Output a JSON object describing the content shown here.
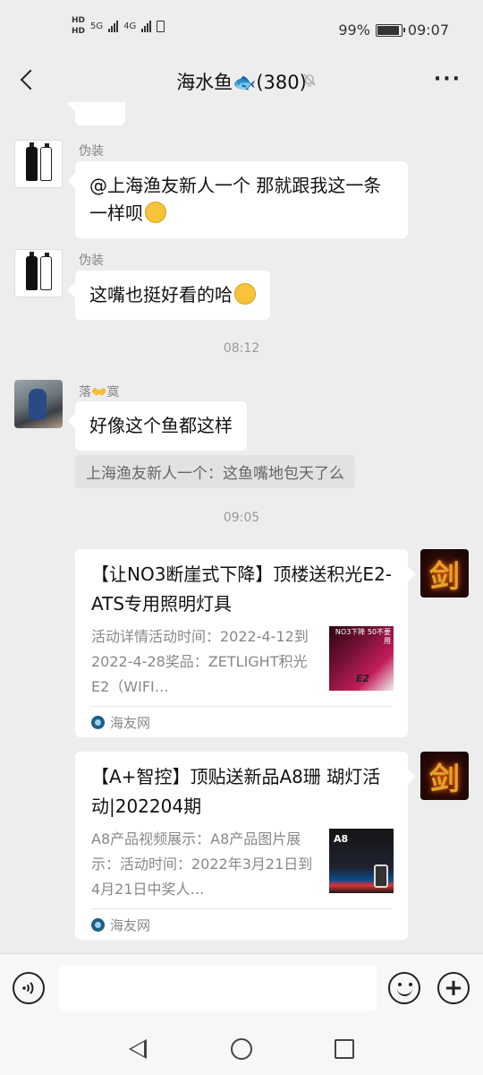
{
  "status_bar": {
    "hd1": "HD",
    "hd2": "HD",
    "net1": "5G",
    "net2": "4G",
    "battery": "99%",
    "time": "09:07"
  },
  "header": {
    "title": "海水鱼🐟(380)",
    "mute_icon": "bell-muted-icon",
    "more_icon": "more-dots-icon"
  },
  "messages": [
    {
      "sender": "伪装",
      "text": "@上海渔友新人一个  那就跟我这一条一样呗"
    },
    {
      "sender": "伪装",
      "text": "这嘴也挺好看的哈"
    },
    {
      "time": "08:12"
    },
    {
      "sender": "落👐寞",
      "text": "好像这个鱼都这样",
      "quote": "上海渔友新人一个：这鱼嘴地包天了么"
    },
    {
      "time": "09:05"
    }
  ],
  "cards": [
    {
      "title": "【让NO3断崖式下降】顶楼送积光E2-ATS专用照明灯具",
      "desc": "活动详情活动时间：2022-4-12到2022-4-28奖品：ZETLIGHT积光E2（WIFI…",
      "thumb_top": "NO3下降 50不要用",
      "thumb_bottom": "E2",
      "source": "海友网"
    },
    {
      "title": "【A+智控】顶贴送新品A8珊 瑚灯活动|202204期",
      "desc": "A8产品视频展示：A8产品图片展示：活动时间：2022年3月21日到4月21日中奖人…",
      "thumb_top": "A8",
      "source": "海友网"
    }
  ],
  "avatar_text": {
    "sword_glyph": "剑"
  },
  "input": {
    "value": "",
    "voice_icon": "voice-icon",
    "emoji_icon": "emoji-icon",
    "plus_icon": "plus-icon",
    "plus_glyph": "+"
  }
}
